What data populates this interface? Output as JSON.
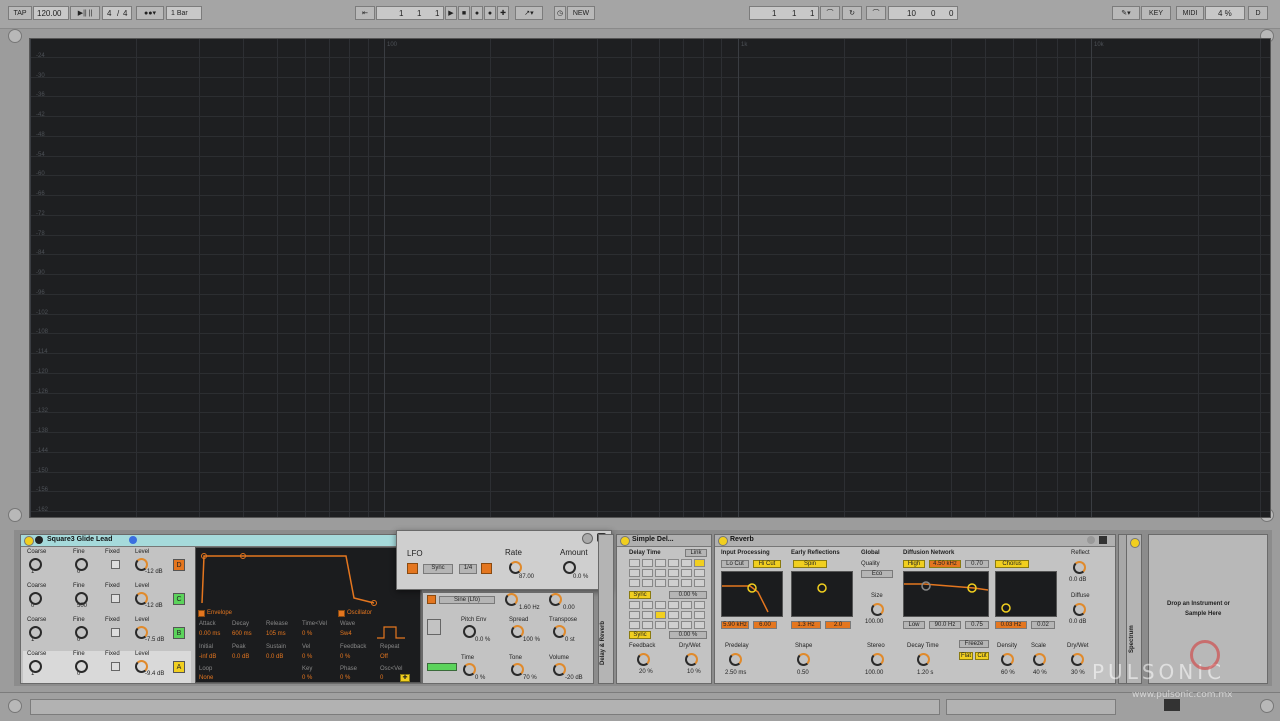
{
  "colors": {
    "accent_orange": "#e4761f",
    "accent_yellow": "#f1cf1f",
    "accent_green": "#5bd35b",
    "header_teal": "#a6dadb",
    "display_bg": "#1e1f21",
    "grid": "#2c2e31"
  },
  "transport": {
    "tap": "TAP",
    "tempo": "120.00",
    "sig_num": "4",
    "sig_den": "4",
    "quant": "1 Bar",
    "arr_pos_1": "1",
    "arr_pos_2": "1",
    "arr_pos_3": "1",
    "new_label": "NEW",
    "loop_pos_1": "1",
    "loop_pos_2": "1",
    "loop_pos_3": "1",
    "loop_len_1": "10",
    "loop_len_2": "0",
    "loop_len_3": "0",
    "key_label": "KEY",
    "midi_label": "MIDI",
    "cpu_label": "4 %",
    "disk_label": "D"
  },
  "spectrum": {
    "y_labels": [
      "-24",
      "-30",
      "-36",
      "-42",
      "-48",
      "-54",
      "-60",
      "-66",
      "-72",
      "-78",
      "-84",
      "-90",
      "-96",
      "-102",
      "-108",
      "-114",
      "-120",
      "-126",
      "-132",
      "-138",
      "-144",
      "-150",
      "-156",
      "-162"
    ],
    "x_labels": [
      "100",
      "1k",
      "10k"
    ]
  },
  "operator": {
    "title": "Square3 Glide Lead",
    "ops": [
      {
        "coarse_label": "Coarse",
        "fine_label": "Fine",
        "fixed_label": "Fixed",
        "level_label": "Level",
        "coarse": "1",
        "fine": "0",
        "level": "-12 dB",
        "tag": "D"
      },
      {
        "coarse_label": "Coarse",
        "fine_label": "Fine",
        "fixed_label": "Fixed",
        "level_label": "Level",
        "coarse": "0",
        "fine": "500",
        "level": "-12 dB",
        "tag": "C"
      },
      {
        "coarse_label": "Coarse",
        "fine_label": "Fine",
        "fixed_label": "Fixed",
        "level_label": "Level",
        "coarse": "1",
        "fine": "0",
        "level": "-7.5 dB",
        "tag": "B"
      },
      {
        "coarse_label": "Coarse",
        "fine_label": "Fine",
        "fixed_label": "Fixed",
        "level_label": "Level",
        "coarse": "1",
        "fine": "0",
        "level": "-9.4 dB",
        "tag": "A"
      }
    ],
    "env": {
      "tab_env": "Envelope",
      "tab_osc": "Oscillator",
      "attack_label": "Attack",
      "decay_label": "Decay",
      "release_label": "Release",
      "time_vel_label": "Time<Vel",
      "wave_label": "Wave",
      "attack": "0.00 ms",
      "decay": "600 ms",
      "release": "105 ms",
      "time_vel": "0 %",
      "wave": "Sw4",
      "initial_label": "Initial",
      "peak_label": "Peak",
      "sustain_label": "Sustain",
      "vel_label": "Vel",
      "feedback_label": "Feedback",
      "repeat_label": "Repeat",
      "initial": "-inf dB",
      "peak": "0.0 dB",
      "sustain": "0.0 dB",
      "vel": "0 %",
      "feedback": "0 %",
      "repeat": "Off",
      "loop_label": "Loop",
      "key_label": "Key",
      "phase_label": "Phase",
      "osc_label": "Osc<Vel",
      "loop": "None",
      "key": "0 %",
      "phase": "0 %",
      "osc": "0"
    }
  },
  "lfo": {
    "title": "LFO",
    "rate_label": "Rate",
    "amount_label": "Amount",
    "rate": "87.00",
    "amount": "0.0 %",
    "sync": "Sync",
    "mode": "1/4",
    "row2_mode": "Sine (Lfo)",
    "rate2": "1.60 Hz",
    "amount2": "0.00",
    "pitch_env_label": "Pitch Env",
    "spread_label": "Spread",
    "transpose_label": "Transpose",
    "pitch_env": "0.0 %",
    "spread": "100 %",
    "transpose": "0 st",
    "time_label": "Time",
    "tone_label": "Tone",
    "volume_label": "Volume",
    "time": "0 %",
    "tone": "70 %",
    "volume": "-20 dB"
  },
  "delay": {
    "title": "Simple Del...",
    "rack": "Delay & Reverb",
    "delay_time_label": "Delay Time",
    "link": "Link",
    "sync": "Sync",
    "sync_val": "0.00 %",
    "sync2": "Sync",
    "sync_val2": "0.00 %",
    "feedback_label": "Feedback",
    "drywet_label": "Dry/Wet",
    "feedback": "20 %",
    "drywet": "10 %"
  },
  "reverb": {
    "title": "Reverb",
    "input_label": "Input Processing",
    "early_label": "Early Reflections",
    "global_label": "Global",
    "diffusion_label": "Diffusion Network",
    "lo_cut": "Lo Cut",
    "hi_cut": "Hi Cut",
    "spin": "Spin",
    "quality_label": "Quality",
    "quality": "Eco",
    "high": "High",
    "high_val": "4.50 kHz",
    "high_amt": "0.70",
    "chorus": "Chorus",
    "filt_freq": "5.90 kHz",
    "filt_width": "6.00",
    "spin_rate": "1.3 Hz",
    "spin_amt": "2.0",
    "size_label": "Size",
    "size": "100.00",
    "low": "Low",
    "low_val": "90.0 Hz",
    "low_amt": "0.75",
    "chorus_rate": "0.03 Hz",
    "chorus_amt": "0.02",
    "predelay_label": "Predelay",
    "shape_label": "Shape",
    "stereo_label": "Stereo",
    "decay_label": "Decay Time",
    "freeze": "Freeze",
    "flat": "Flat",
    "cut": "Cut",
    "density_label": "Density",
    "scale_label": "Scale",
    "drywet_label": "Dry/Wet",
    "reflect_label": "Reflect",
    "diffuse_label": "Diffuse",
    "predelay": "2.50 ms",
    "shape": "0.50",
    "stereo": "100.00",
    "decay": "1.20 s",
    "density": "60 %",
    "scale": "40 %",
    "drywet": "30 %",
    "reflect": "0.0 dB",
    "diffuse": "0.0 dB"
  },
  "spectrum_device": {
    "title": "Spectrum"
  },
  "drop": {
    "line1": "Drop an Instrument or",
    "line2": "Sample Here"
  },
  "watermark": {
    "brand": "PULSONIC",
    "url": "www.pulsonic.com.mx"
  }
}
